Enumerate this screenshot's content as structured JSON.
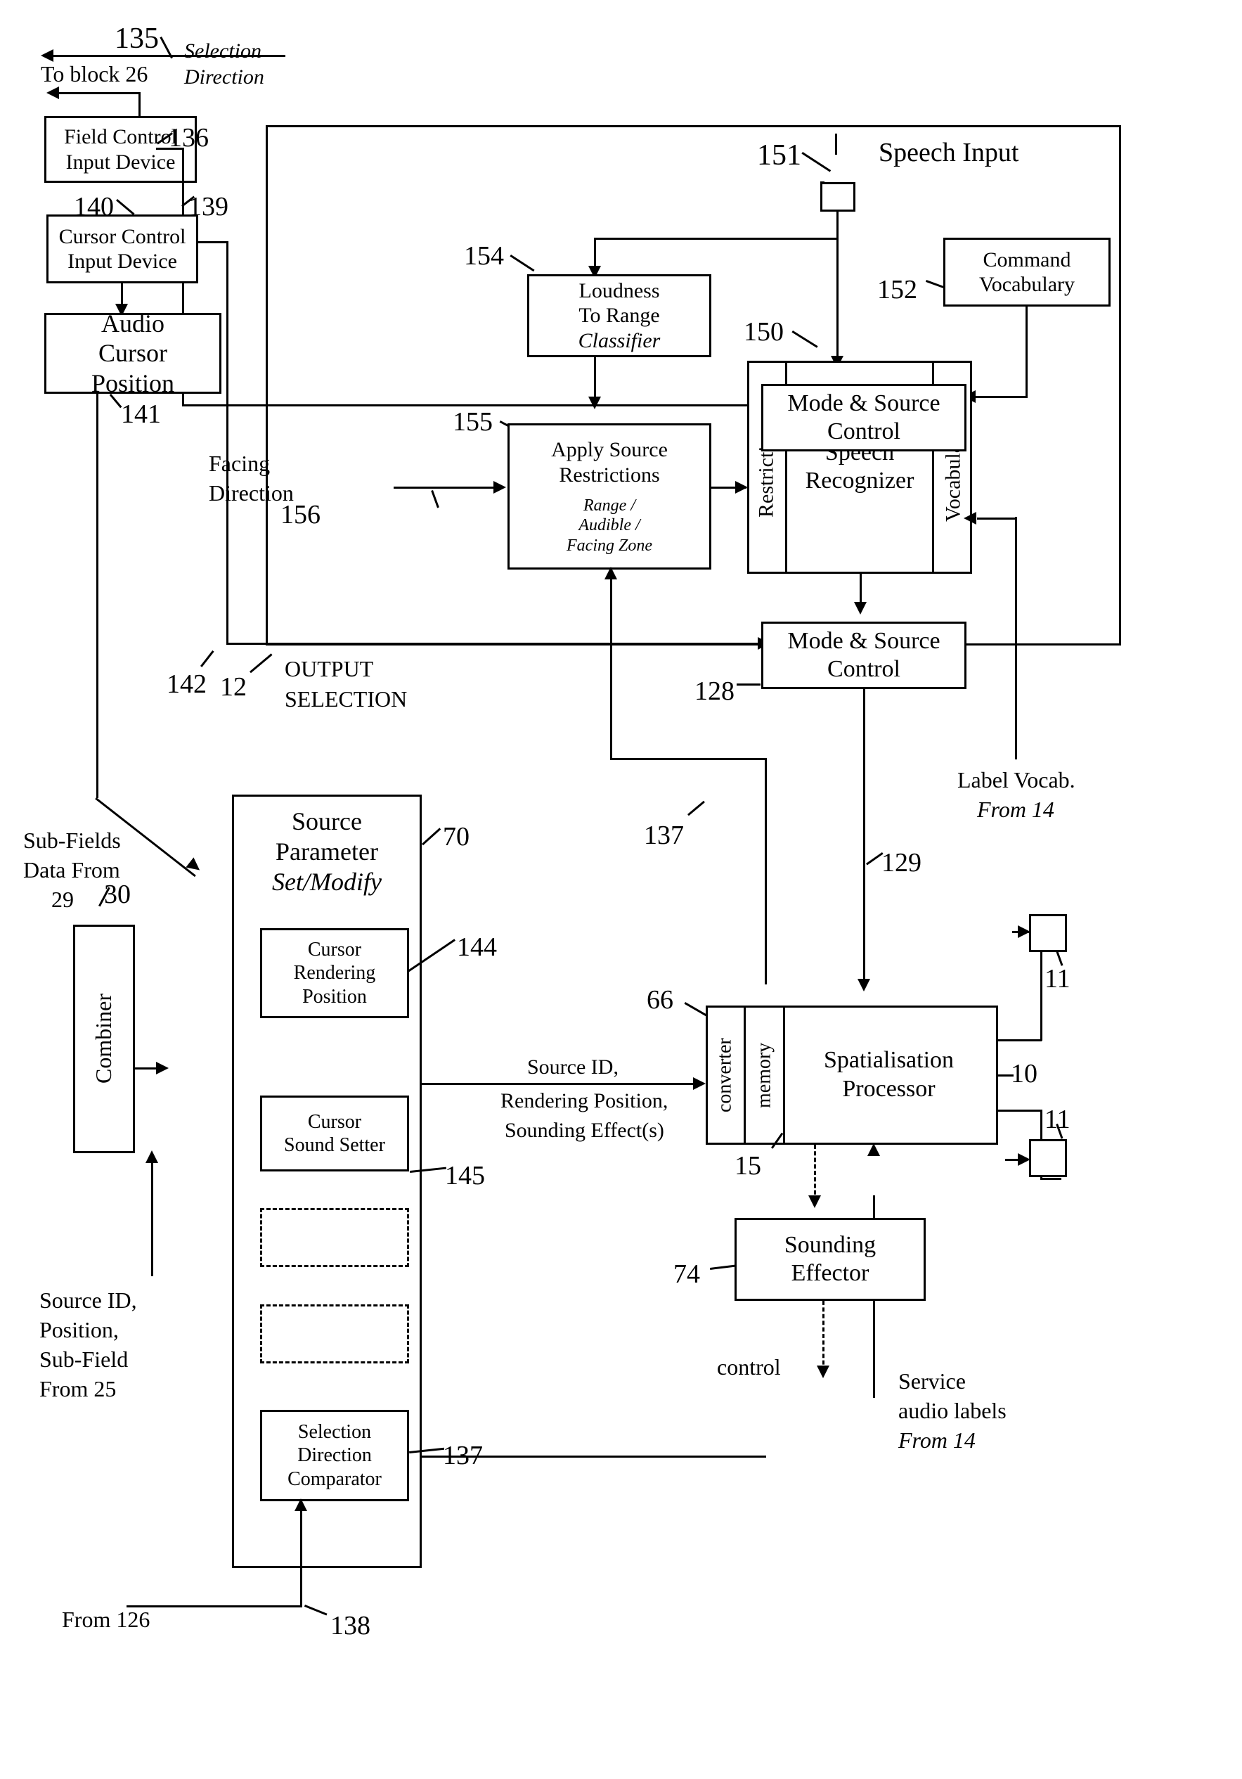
{
  "figure": {
    "type": "patent-block-diagram",
    "title": "Audio cursor / speech-controlled spatialisation block diagram"
  },
  "annotations": {
    "n135": "135",
    "n136": "136",
    "n139": "139",
    "n140": "140",
    "n141": "141",
    "n142": "142",
    "n12": "12",
    "n150": "150",
    "n151": "151",
    "n152": "152",
    "n154": "154",
    "n155": "155",
    "n156": "156",
    "n128": "128",
    "n129": "129",
    "n137": "137",
    "n137b": "137",
    "n138": "138",
    "n144": "144",
    "n145": "145",
    "n70": "70",
    "n29": "29",
    "n30": "30",
    "n66": "66",
    "n15": "15",
    "n10": "10",
    "n11a": "11",
    "n11b": "11",
    "n74": "74"
  },
  "labels": {
    "selection_direction_l1": "Selection",
    "selection_direction_l2": "Direction",
    "to_block_26": "To block 26",
    "speech_input": "Speech Input",
    "facing_l1": "Facing",
    "facing_l2": "Direction",
    "output_selection_l1": "OUTPUT",
    "output_selection_l2": "SELECTION",
    "label_vocab_l1": "Label Vocab.",
    "label_vocab_l2": "From 14",
    "subfields_l1": "Sub-Fields",
    "subfields_l2": "Data From",
    "subfields_l3": "29",
    "sourceid_from25_l1": "Source ID,",
    "sourceid_from25_l2": "Position,",
    "sourceid_from25_l3": "Sub-Field",
    "sourceid_from25_l4": "From 25",
    "from_126": "From 126",
    "sourceid_bus_l1": "Source ID,",
    "sourceid_bus_l2": "Rendering Position,",
    "sourceid_bus_l3": "Sounding Effect(s)",
    "control": "control",
    "service_audio_l1": "Service",
    "service_audio_l2": "audio labels",
    "service_audio_l3": "From 14"
  },
  "blocks": {
    "field_control": {
      "l1": "Field Control",
      "l2": "Input Device"
    },
    "cursor_control": {
      "l1": "Cursor Control",
      "l2": "Input Device"
    },
    "audio_cursor_position": {
      "l1": "Audio",
      "l2": "Cursor",
      "l3": "Position"
    },
    "loudness_to_range": {
      "l1": "Loudness",
      "l2": "To Range",
      "l3": "Classifier"
    },
    "command_vocabulary": {
      "l1": "Command",
      "l2": "Vocabulary"
    },
    "apply_source_restrictions": {
      "l1": "Apply Source",
      "l2": "Restrictions",
      "s1": "Range /",
      "s2": "Audible /",
      "s3": "Facing Zone"
    },
    "speech_recognizer": {
      "left_tab": "Restrictions",
      "center_l1": "Speech",
      "center_l2": "Recognizer",
      "right_tab": "Vocabularies"
    },
    "mode_source_control": {
      "l1": "Mode & Source",
      "l2": "Control"
    },
    "source_parameter": {
      "l1": "Source",
      "l2": "Parameter",
      "l3": "Set/Modify"
    },
    "cursor_rendering_position": {
      "l1": "Cursor",
      "l2": "Rendering",
      "l3": "Position"
    },
    "cursor_sound_setter": {
      "l1": "Cursor",
      "l2": "Sound Setter"
    },
    "empty_slot_1": {
      "l1": ""
    },
    "empty_slot_2": {
      "l1": ""
    },
    "selection_direction_comparator": {
      "l1": "Selection",
      "l2": "Direction",
      "l3": "Comparator"
    },
    "combiner": {
      "l1": "Combiner"
    },
    "spatialisation_processor": {
      "left_tab": "converter",
      "mid_tab": "memory",
      "center_l1": "Spatialisation",
      "center_l2": "Processor"
    },
    "sounding_effector": {
      "l1": "Sounding",
      "l2": "Effector"
    },
    "output_node_a": {
      "l1": ""
    },
    "output_node_b": {
      "l1": ""
    },
    "speech_input_node": {
      "l1": ""
    }
  },
  "colors": {
    "ink": "#000000",
    "paper": "#ffffff"
  }
}
